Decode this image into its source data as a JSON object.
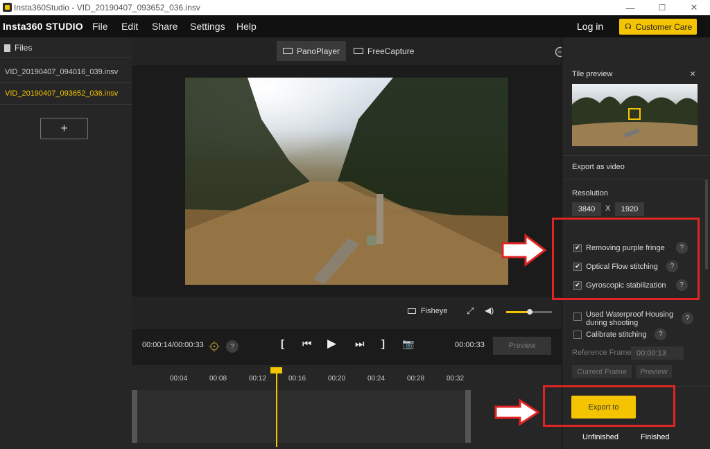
{
  "window": {
    "title": "Insta360Studio - VID_20190407_093652_036.insv",
    "minimize": "—",
    "maximize": "☐",
    "close": "✕"
  },
  "menubar": {
    "logo": "Insta360 STUDIO",
    "items": [
      "File",
      "Edit",
      "Share",
      "Settings",
      "Help"
    ],
    "login": "Log in",
    "customer_care": "Customer Care"
  },
  "files": {
    "header": "Files",
    "items": [
      {
        "name": "VID_20190407_094016_039.insv",
        "active": false
      },
      {
        "name": "VID_20190407_093652_036.insv",
        "active": true
      }
    ],
    "add": "+"
  },
  "view_tabs": {
    "panoplayer": "PanoPlayer",
    "freecapture": "FreeCapture"
  },
  "player": {
    "view_mode": "Fisheye",
    "current_time": "00:00:14/00:00:33",
    "end_time": "00:00:33",
    "preview": "Preview",
    "help": "?",
    "volume": 0.5
  },
  "timeline": {
    "ticks": [
      "00:04",
      "00:08",
      "00:12",
      "00:16",
      "00:20",
      "00:24",
      "00:28",
      "00:32"
    ]
  },
  "tile_preview": {
    "title": "Tile preview",
    "close": "×"
  },
  "export_panel": {
    "section_title": "Export as video",
    "resolution_label": "Resolution",
    "width": "3840",
    "x": "X",
    "height": "1920",
    "options": [
      {
        "label": "Removing purple fringe",
        "checked": true
      },
      {
        "label": "Optical Flow stitching",
        "checked": true
      },
      {
        "label": "Gyroscopic stabilization",
        "checked": true
      }
    ],
    "waterproof_line1": "Used Waterproof Housing",
    "waterproof_line2": "during shooting",
    "calibrate": "Calibrate stitching",
    "reference_frame_label": "Reference Frame",
    "reference_frame_value": "00:00:13",
    "current_frame": "Current Frame",
    "preview": "Preview",
    "export_to": "Export to",
    "tab_unfinished": "Unfinished",
    "tab_finished": "Finished",
    "help": "?"
  },
  "colors": {
    "accent": "#f5c400",
    "annotation": "#e02424"
  }
}
